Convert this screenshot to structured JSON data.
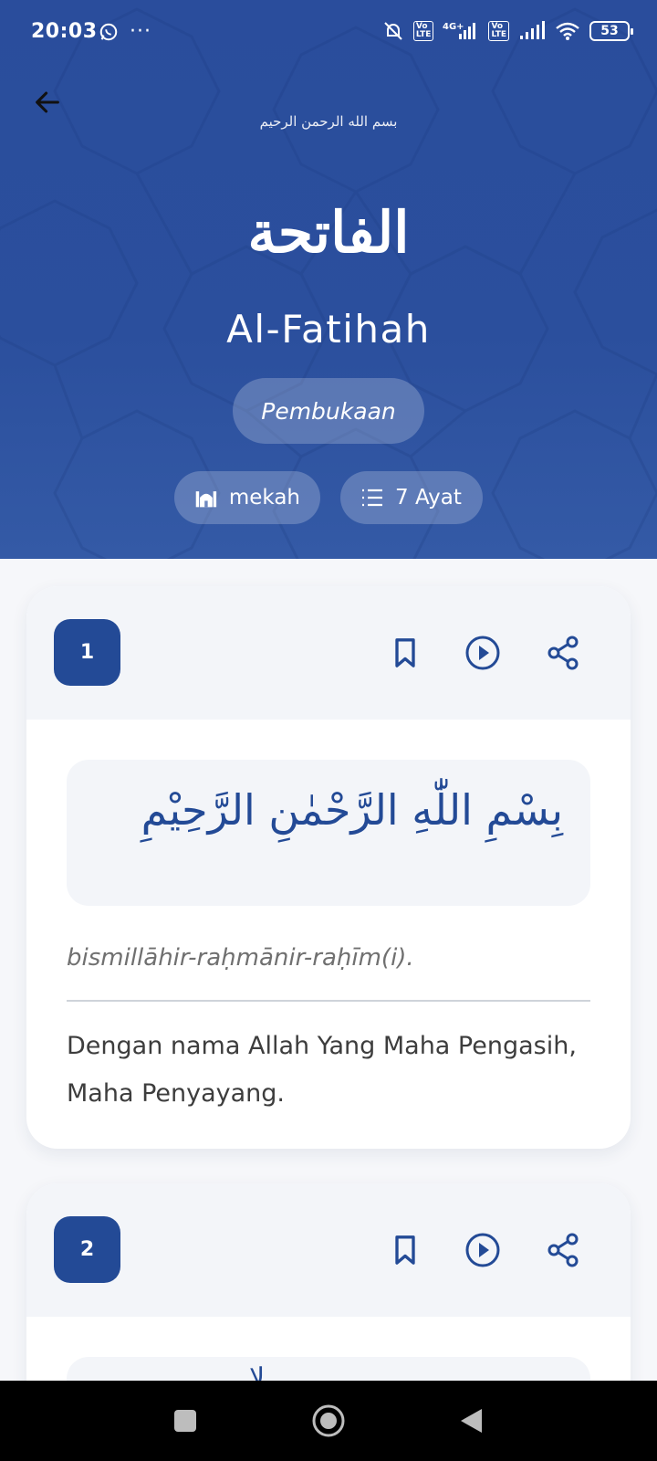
{
  "status": {
    "time": "20:03",
    "battery": "53",
    "lte_label": "Vo LTE",
    "network": "4G+"
  },
  "header": {
    "bismillah_small": "بسم الله الرحمن الرحيم",
    "surah_arabic": "الفاتحة",
    "surah_latin": "Al-Fatihah",
    "meaning": "Pembukaan",
    "place": "mekah",
    "ayat_count": "7 Ayat"
  },
  "ayat": [
    {
      "number": "1",
      "arabic": "بِسْمِ اللّٰهِ الرَّحْمٰنِ الرَّحِيْمِ",
      "transliteration": "bismillāhir-raḥmānir-raḥīm(i).",
      "translation": "Dengan nama Allah Yang Maha Pengasih, Maha Penyayang."
    },
    {
      "number": "2",
      "arabic_peek": "لا"
    }
  ],
  "icons": {
    "back": "arrow-left-icon",
    "bookmark": "bookmark-icon",
    "play": "play-circle-icon",
    "share": "share-icon",
    "mosque": "mosque-icon",
    "list": "list-icon"
  },
  "colors": {
    "primary": "#234a96",
    "header_bg": "#2b4f9d",
    "card_head_bg": "#f3f5f9"
  }
}
